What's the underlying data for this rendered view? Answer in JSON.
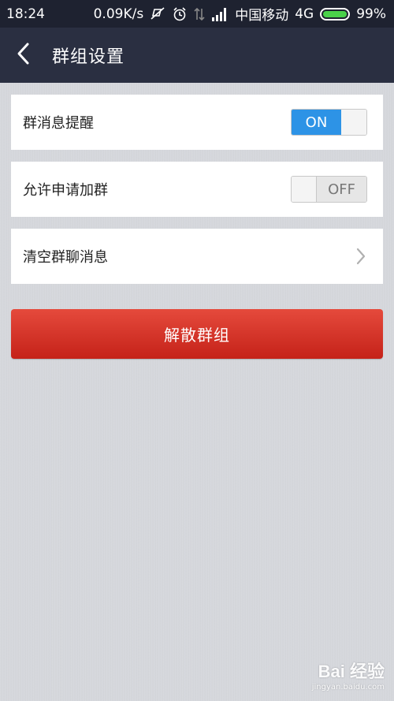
{
  "status_bar": {
    "time": "18:24",
    "speed": "0.09K/s",
    "carrier": "中国移动",
    "network": "4G",
    "battery": "99%",
    "battery_level": 0.99,
    "icons": [
      "mute-icon",
      "alarm-icon",
      "data-arrows-icon",
      "signal-icon",
      "battery-icon"
    ]
  },
  "header": {
    "back_icon": "chevron-left-icon",
    "title": "群组设置"
  },
  "settings": [
    {
      "label": "群消息提醒",
      "control": "toggle",
      "state": "ON"
    },
    {
      "label": "允许申请加群",
      "control": "toggle",
      "state": "OFF"
    },
    {
      "label": "清空群聊消息",
      "control": "chevron",
      "icon": "chevron-right-icon"
    }
  ],
  "dissolve_button": {
    "label": "解散群组"
  },
  "watermark": {
    "brand": "Bai 经验",
    "url": "jingyan.baidu.com"
  },
  "colors": {
    "header_bg": "#2a2f41",
    "toggle_on": "#2d93e6",
    "danger": "#d2352a"
  }
}
